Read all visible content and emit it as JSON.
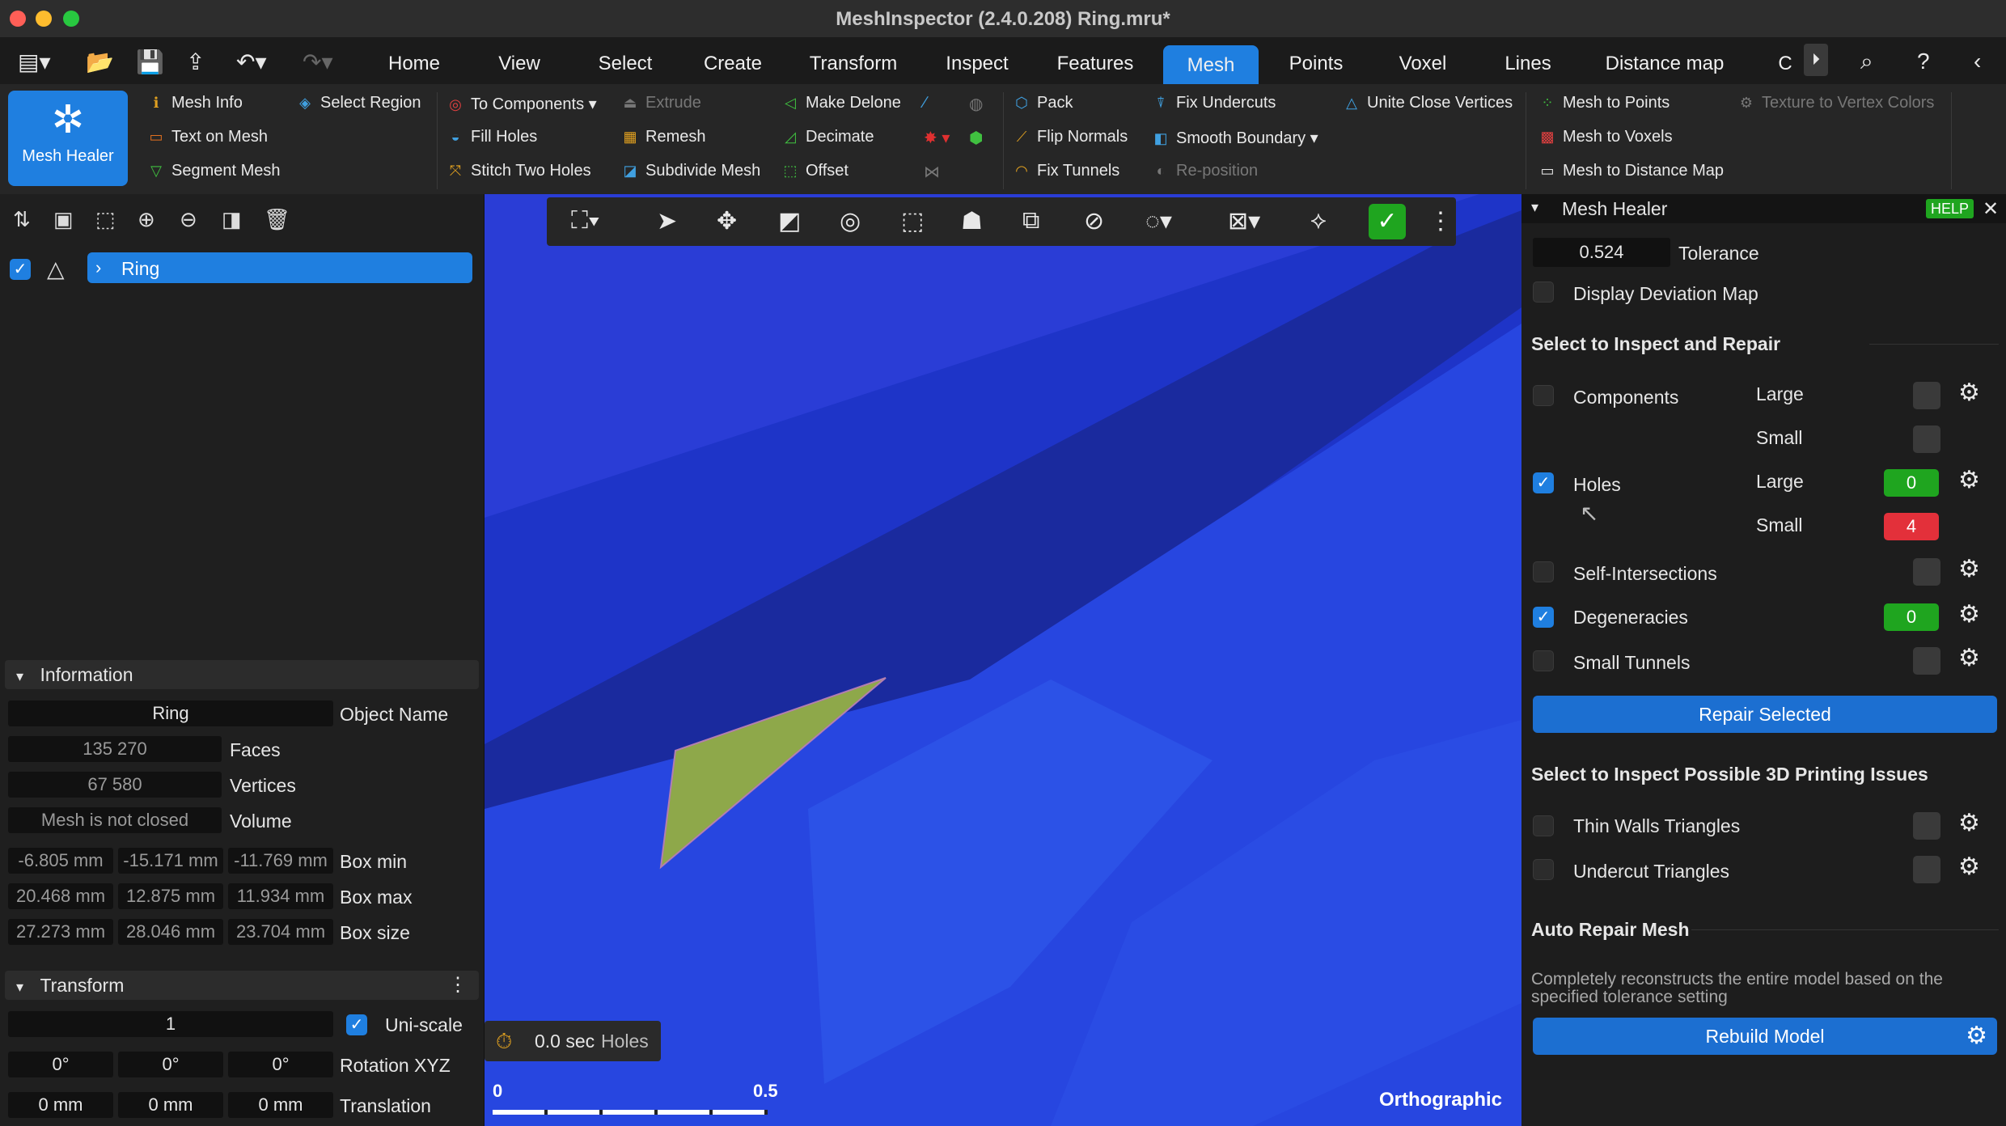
{
  "window": {
    "title": "MeshInspector (2.4.0.208) Ring.mru*"
  },
  "menu": {
    "tabs": [
      "Home",
      "View",
      "Select",
      "Create",
      "Transform",
      "Inspect",
      "Features",
      "Mesh",
      "Points",
      "Voxel",
      "Lines",
      "Distance map",
      "C"
    ],
    "active": "Mesh"
  },
  "ribbon": {
    "big_button": "Mesh Healer",
    "col1": [
      "Mesh Info",
      "Text on Mesh",
      "Segment Mesh"
    ],
    "col2": [
      "Select Region"
    ],
    "col3": [
      "To Components",
      "Fill Holes",
      "Stitch Two Holes"
    ],
    "col4": [
      "Extrude",
      "Remesh",
      "Subdivide Mesh"
    ],
    "col5": [
      "Make Delone",
      "Decimate",
      "Offset"
    ],
    "col6": [
      "Pack",
      "Flip Normals",
      "Fix Tunnels"
    ],
    "col7": [
      "Fix Undercuts",
      "Smooth Boundary",
      "Re-position"
    ],
    "col8": [
      "Unite Close Vertices"
    ],
    "col9": [
      "Mesh to Points",
      "Mesh to Voxels",
      "Mesh to Distance Map"
    ],
    "col10": [
      "Texture to Vertex Colors"
    ]
  },
  "tree": {
    "item": "Ring"
  },
  "info": {
    "title": "Information",
    "object_name": "Ring",
    "object_name_label": "Object Name",
    "faces": "135 270",
    "faces_label": "Faces",
    "vertices": "67 580",
    "vertices_label": "Vertices",
    "volume": "Mesh is not closed",
    "volume_label": "Volume",
    "box_min": [
      "-6.805 mm",
      "-15.171 mm",
      "-11.769 mm"
    ],
    "box_min_label": "Box min",
    "box_max": [
      "20.468 mm",
      "12.875 mm",
      "11.934 mm"
    ],
    "box_max_label": "Box max",
    "box_size": [
      "27.273 mm",
      "28.046 mm",
      "23.704 mm"
    ],
    "box_size_label": "Box size"
  },
  "transform": {
    "title": "Transform",
    "scale": "1",
    "uniscale_label": "Uni-scale",
    "rotation": [
      "0°",
      "0°",
      "0°"
    ],
    "rotation_label": "Rotation XYZ",
    "translation": [
      "0 mm",
      "0 mm",
      "0 mm"
    ],
    "translation_label": "Translation"
  },
  "viewport": {
    "timer": "0.0 sec",
    "timer_mode": "Holes",
    "scale_start": "0",
    "scale_end": "0.5",
    "projection": "Orthographic"
  },
  "healer": {
    "title": "Mesh Healer",
    "help": "HELP",
    "tolerance_value": "0.524",
    "tolerance_label": "Tolerance",
    "deviation_label": "Display Deviation Map",
    "inspect_header": "Select to Inspect and Repair",
    "components_label": "Components",
    "large_label": "Large",
    "small_label": "Small",
    "holes_label": "Holes",
    "holes_large": "0",
    "holes_small": "4",
    "self_intersections_label": "Self-Intersections",
    "degeneracies_label": "Degeneracies",
    "degeneracies_count": "0",
    "small_tunnels_label": "Small Tunnels",
    "repair_button": "Repair Selected",
    "printing_header": "Select to Inspect Possible 3D Printing Issues",
    "thin_walls_label": "Thin Walls Triangles",
    "undercut_label": "Undercut Triangles",
    "auto_header": "Auto Repair Mesh",
    "auto_desc": "Completely reconstructs the entire model based on the specified tolerance setting",
    "rebuild_button": "Rebuild Model"
  },
  "colors": {
    "accent": "#1f7fe0",
    "green": "#1fa51f",
    "red": "#e3303a",
    "mesh_blue": "#2a3dd6",
    "highlight": "#8ea84a"
  }
}
